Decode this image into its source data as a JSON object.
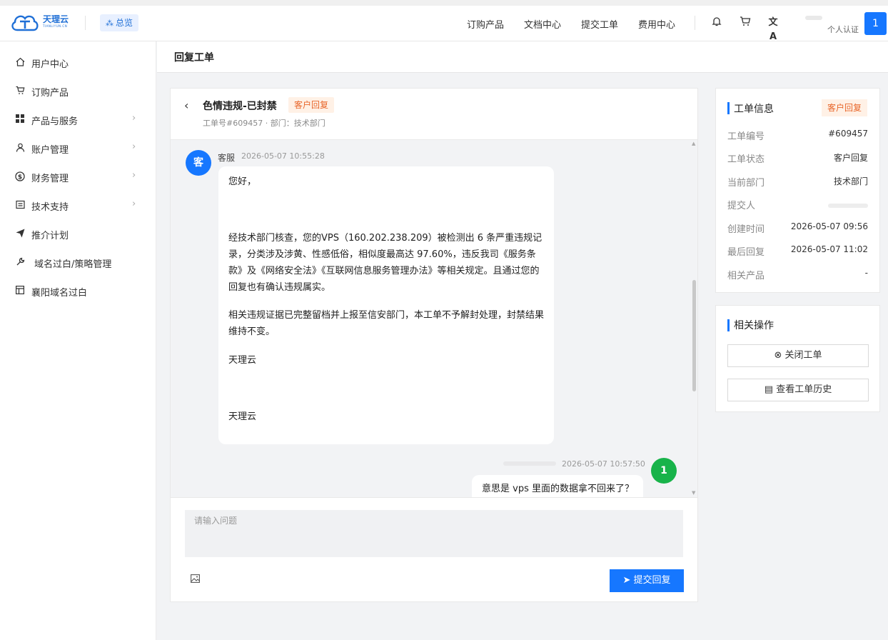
{
  "brand": {
    "name": "天理云",
    "sub": "TIANLIYUN.CN",
    "color": "#1f6fd6"
  },
  "header": {
    "overview_label": "总览",
    "nav": [
      "订购产品",
      "文档中心",
      "提交工单",
      "费用中心"
    ],
    "icons": [
      "bell-icon",
      "cart-icon",
      "translate-icon"
    ],
    "cert_label": "个人认证",
    "user_badge": "1"
  },
  "sidebar": {
    "items": [
      {
        "label": "用户中心",
        "icon": "home-icon",
        "arrow": false
      },
      {
        "label": "订购产品",
        "icon": "cart-icon",
        "arrow": false
      },
      {
        "label": "产品与服务",
        "icon": "grid-icon",
        "arrow": true
      },
      {
        "label": "账户管理",
        "icon": "user-icon",
        "arrow": true
      },
      {
        "label": "财务管理",
        "icon": "dollar-icon",
        "arrow": true
      },
      {
        "label": "技术支持",
        "icon": "doc-icon",
        "arrow": true
      },
      {
        "label": "推介计划",
        "icon": "send-icon",
        "arrow": false
      },
      {
        "label": "域名过白/策略管理",
        "icon": "wrench-icon",
        "arrow": false
      },
      {
        "label": "襄阳域名过白",
        "icon": "table-icon",
        "arrow": false
      }
    ]
  },
  "page": {
    "title": "回复工单"
  },
  "ticket": {
    "title": "色情违规-已封禁",
    "status": "客户回复",
    "meta": "工单号#609457 · 部门：技术部门"
  },
  "messages": [
    {
      "avatar": "客",
      "name": "客服",
      "time": "2026-05-07 10:55:28",
      "paragraphs": [
        "您好，",
        "经技术部门核查，您的VPS（160.202.238.209）被检测出 6 条严重违规记录，分类涉及涉黄、性感低俗，相似度最高达 97.60%，违反我司《服务条款》及《网络安全法》《互联网信息服务管理办法》等相关规定。且通过您的回复也有确认违规属实。",
        "相关违规证据已完整留档并上报至信安部门，本工单不予解封处理，封禁结果维持不变。",
        "天理云",
        "天理云"
      ]
    },
    {
      "avatar": "1",
      "time": "2026-05-07 10:57:50",
      "text": "意思是 vps 里面的数据拿不回来了？"
    }
  ],
  "reply": {
    "placeholder": "请输入问题",
    "submit_label": "提交回复"
  },
  "info": {
    "title": "工单信息",
    "status_tag": "客户回复",
    "rows": [
      {
        "k": "工单编号",
        "v": "#609457"
      },
      {
        "k": "工单状态",
        "v": "客户回复"
      },
      {
        "k": "当前部门",
        "v": "技术部门"
      },
      {
        "k": "提交人",
        "v": ""
      },
      {
        "k": "创建时间",
        "v": "2026-05-07 09:56"
      },
      {
        "k": "最后回复",
        "v": "2026-05-07 11:02"
      },
      {
        "k": "相关产品",
        "v": "-"
      }
    ]
  },
  "ops": {
    "title": "相关操作",
    "close_label": "关闭工单",
    "history_label": "查看工单历史"
  },
  "colors": {
    "primary": "#1677ff",
    "warning_bg": "#fff1e6",
    "warning_text": "#e8662a",
    "green": "#18b34a"
  }
}
